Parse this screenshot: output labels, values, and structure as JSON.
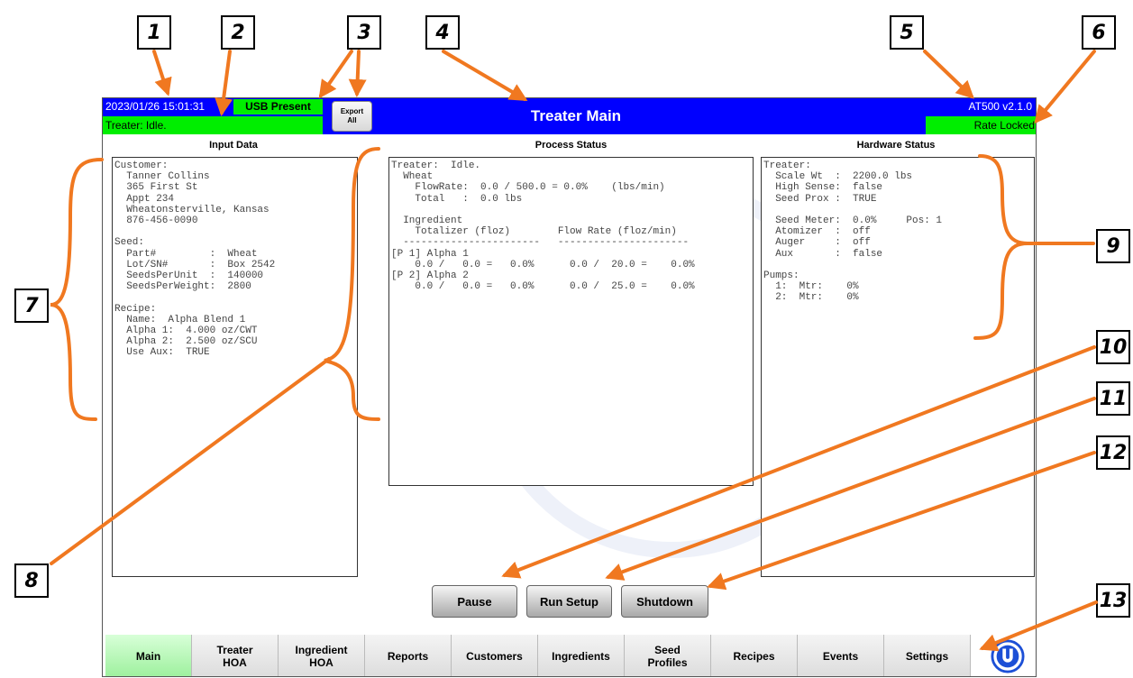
{
  "callouts": [
    "1",
    "2",
    "3",
    "4",
    "5",
    "6",
    "7",
    "8",
    "9",
    "10",
    "11",
    "12",
    "13"
  ],
  "header": {
    "datetime": "2023/01/26 15:01:31",
    "usb": "USB Present",
    "treater_status": "Treater: Idle.",
    "export_line1": "Export",
    "export_line2": "All",
    "title": "Treater Main",
    "version": "AT500 v2.1.0",
    "rate_locked": "Rate Locked"
  },
  "panels": {
    "input_title": "Input Data",
    "process_title": "Process Status",
    "hardware_title": "Hardware Status",
    "input_text": "Customer:\n  Tanner Collins\n  365 First St\n  Appt 234\n  Wheatonsterville, Kansas\n  876-456-0090\n\nSeed:\n  Part#         :  Wheat\n  Lot/SN#       :  Box 2542\n  SeedsPerUnit  :  140000\n  SeedsPerWeight:  2800\n\nRecipe:\n  Name:  Alpha Blend 1\n  Alpha 1:  4.000 oz/CWT\n  Alpha 2:  2.500 oz/SCU\n  Use Aux:  TRUE",
    "process_text": "Treater:  Idle.\n  Wheat\n    FlowRate:  0.0 / 500.0 = 0.0%    (lbs/min)\n    Total   :  0.0 lbs\n\n  Ingredient\n    Totalizer (floz)        Flow Rate (floz/min)\n  -----------------------   ----------------------\n[P 1] Alpha 1\n    0.0 /   0.0 =   0.0%      0.0 /  20.0 =    0.0%\n[P 2] Alpha 2\n    0.0 /   0.0 =   0.0%      0.0 /  25.0 =    0.0%",
    "hardware_text": "Treater:\n  Scale Wt  :  2200.0 lbs\n  High Sense:  false\n  Seed Prox :  TRUE\n\n  Seed Meter:  0.0%     Pos: 1\n  Atomizer  :  off\n  Auger     :  off\n  Aux       :  false\n\nPumps:\n  1:  Mtr:    0%\n  2:  Mtr:    0%"
  },
  "buttons": {
    "pause": "Pause",
    "run_setup": "Run Setup",
    "shutdown": "Shutdown"
  },
  "tabs": [
    {
      "l1": "Main",
      "l2": ""
    },
    {
      "l1": "Treater",
      "l2": "HOA"
    },
    {
      "l1": "Ingredient",
      "l2": "HOA"
    },
    {
      "l1": "Reports",
      "l2": ""
    },
    {
      "l1": "Customers",
      "l2": ""
    },
    {
      "l1": "Ingredients",
      "l2": ""
    },
    {
      "l1": "Seed",
      "l2": "Profiles"
    },
    {
      "l1": "Recipes",
      "l2": ""
    },
    {
      "l1": "Events",
      "l2": ""
    },
    {
      "l1": "Settings",
      "l2": ""
    }
  ],
  "colors": {
    "header_blue": "#0000ff",
    "status_green": "#00ee00",
    "callout_orange": "#f07820"
  },
  "logo_icon": "u-logo-icon"
}
